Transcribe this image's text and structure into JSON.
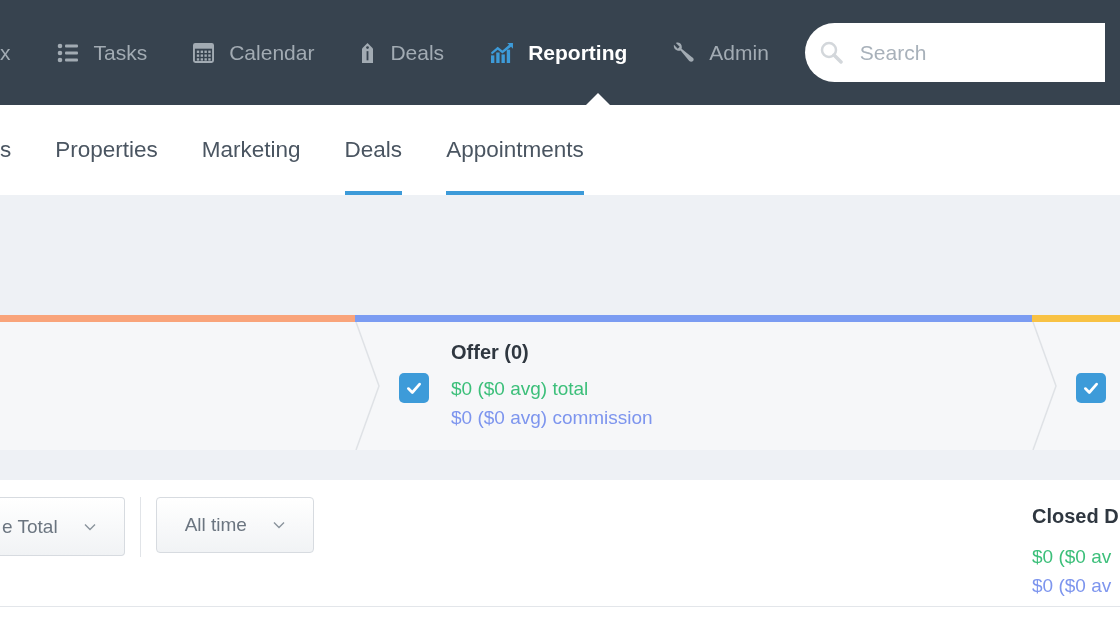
{
  "nav": {
    "items": [
      {
        "label": "x",
        "selected": false
      },
      {
        "label": "Tasks",
        "selected": false
      },
      {
        "label": "Calendar",
        "selected": false
      },
      {
        "label": "Deals",
        "selected": false
      },
      {
        "label": "Reporting",
        "selected": true
      },
      {
        "label": "Admin",
        "selected": false
      }
    ],
    "search": {
      "placeholder": "Search"
    }
  },
  "subnav": {
    "tabs": [
      {
        "label": "s",
        "selected": false
      },
      {
        "label": "Properties",
        "selected": false
      },
      {
        "label": "Marketing",
        "selected": false
      },
      {
        "label": "Deals",
        "selected": true
      },
      {
        "label": "Appointments",
        "selected": true
      }
    ]
  },
  "pipeline": {
    "stages": [
      {
        "color": "#f9a47b"
      },
      {
        "color": "#7b9cf2",
        "checked": true,
        "title": "Offer (0)",
        "total": "$0 ($0 avg) total",
        "commission": "$0 ($0 avg) commission"
      },
      {
        "color": "#f8c244",
        "checked": true
      }
    ]
  },
  "filters": [
    {
      "label": "e Total"
    },
    {
      "label": "All time"
    }
  ],
  "summary": {
    "title": "Closed D",
    "total": "$0 ($0 av",
    "commission": "$0 ($0 av"
  }
}
